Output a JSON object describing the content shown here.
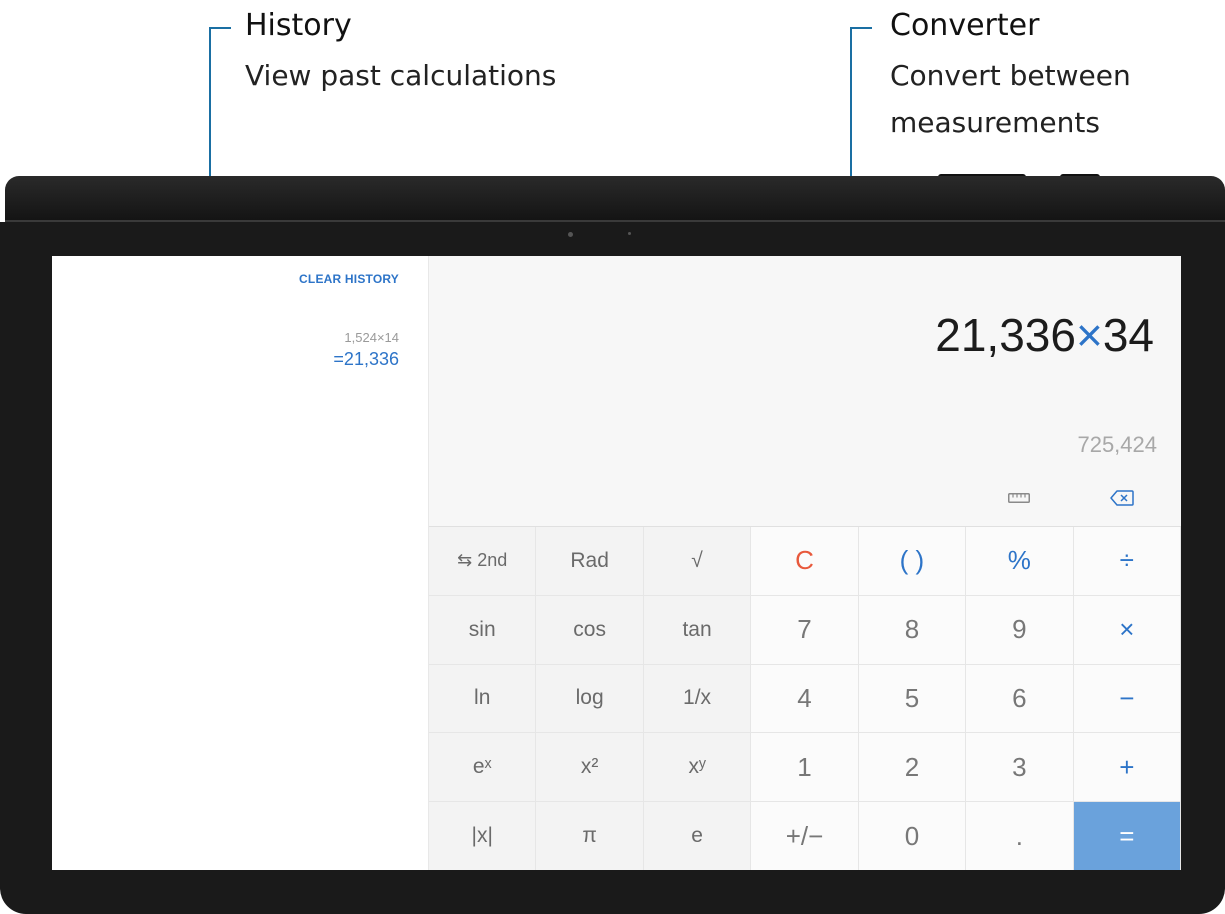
{
  "callouts": {
    "history": {
      "title": "History",
      "description": "View past calculations"
    },
    "converter": {
      "title": "Converter",
      "description_lines": [
        "Convert between",
        "measurements"
      ]
    }
  },
  "colors": {
    "accent": "#2d74c8",
    "clear": "#e8593c",
    "equals_bg": "#6aa2dc",
    "callout_line": "#1a6fa3"
  },
  "history": {
    "clear_label": "CLEAR HISTORY",
    "entries": [
      {
        "expression": "1,524×14",
        "result": "=21,336"
      }
    ]
  },
  "display": {
    "expression_left": "21,336",
    "expression_operator": "×",
    "expression_right": "34",
    "result_preview": "725,424",
    "icons": [
      "ruler-icon",
      "backspace-icon"
    ]
  },
  "keypad": {
    "rows": [
      [
        "⇆ 2nd",
        "Rad",
        "√",
        "C",
        "( )",
        "%",
        "÷"
      ],
      [
        "sin",
        "cos",
        "tan",
        "7",
        "8",
        "9",
        "×"
      ],
      [
        "ln",
        "log",
        "1/x",
        "4",
        "5",
        "6",
        "−"
      ],
      [
        "eˣ",
        "x²",
        "xʸ",
        "1",
        "2",
        "3",
        "+"
      ],
      [
        "|x|",
        "π",
        "e",
        "+/−",
        "0",
        ".",
        "="
      ]
    ]
  }
}
